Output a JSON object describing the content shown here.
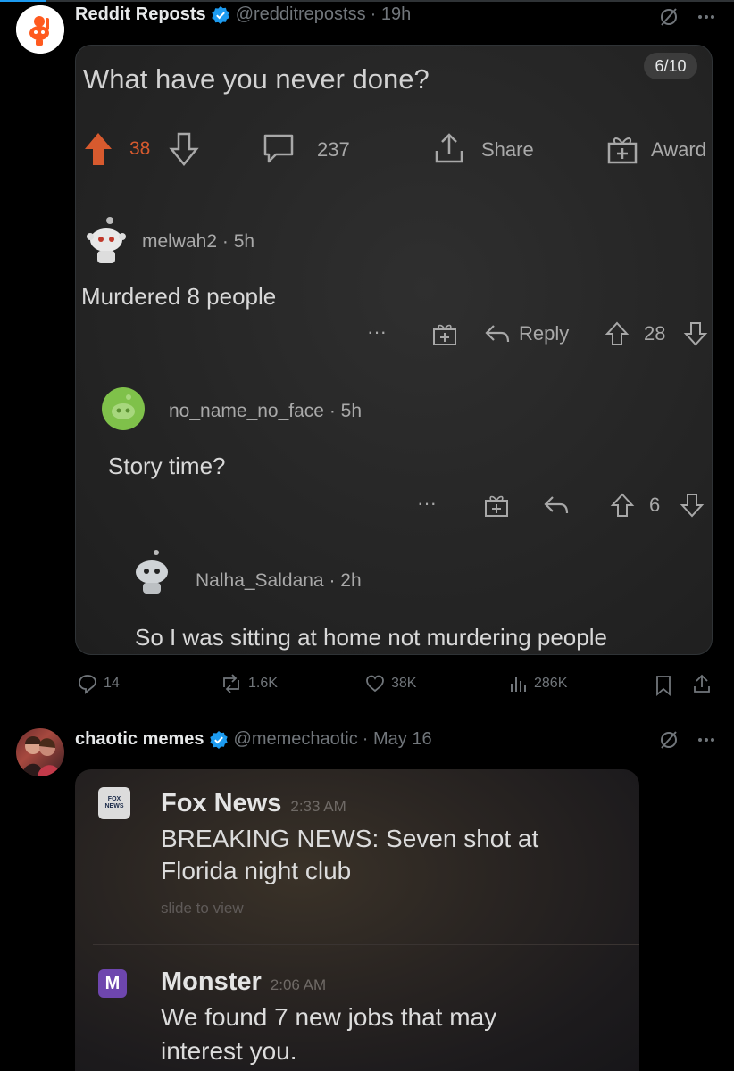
{
  "tweet1": {
    "display_name": "Reddit Reposts",
    "handle": "@redditrepostss",
    "time": "· 19h",
    "card": {
      "counter": "6/10",
      "post_title": "What have you never done?",
      "votes": "38",
      "comments": "237",
      "share_label": "Share",
      "award_label": "Award",
      "comments_list": [
        {
          "user": "melwah2",
          "time": "· 5h",
          "text": "Murdered 8 people",
          "reply_label": "Reply",
          "more": "···",
          "votes": "28"
        },
        {
          "user": "no_name_no_face",
          "time": "· 5h",
          "text": "Story time?",
          "more": "···",
          "votes": "6"
        },
        {
          "user": "Nalha_Saldana",
          "time": "· 2h",
          "text": "So I was sitting at home not murdering people"
        }
      ]
    },
    "stats": {
      "replies": "14",
      "reposts": "1.6K",
      "likes": "38K",
      "views": "286K"
    }
  },
  "tweet2": {
    "display_name": "chaotic memes",
    "handle": "@memechaotic",
    "time": "· May 16",
    "card": {
      "notifications": [
        {
          "app": "Fox News",
          "time": "2:33 AM",
          "body_line1": "BREAKING NEWS: Seven shot at",
          "body_line2": "Florida night club",
          "hint": "slide to view",
          "icon_text": "FOX NEWS"
        },
        {
          "app": "Monster",
          "time": "2:06 AM",
          "body_line1": "We found 7 new jobs that may",
          "body_line2": "interest you.",
          "icon_text": "M"
        }
      ]
    }
  },
  "colors": {
    "background": "#000000",
    "verified": "#1d9bf0",
    "upvote": "#d75a2e",
    "muted": "#71767b",
    "monster": "#6e46ae"
  },
  "icons": [
    "verified-badge-icon",
    "grok-icon",
    "more-icon",
    "upvote-icon",
    "downvote-icon",
    "comment-icon",
    "share-icon",
    "award-icon",
    "reply-icon",
    "repost-icon",
    "like-icon",
    "views-icon",
    "bookmark-icon"
  ]
}
